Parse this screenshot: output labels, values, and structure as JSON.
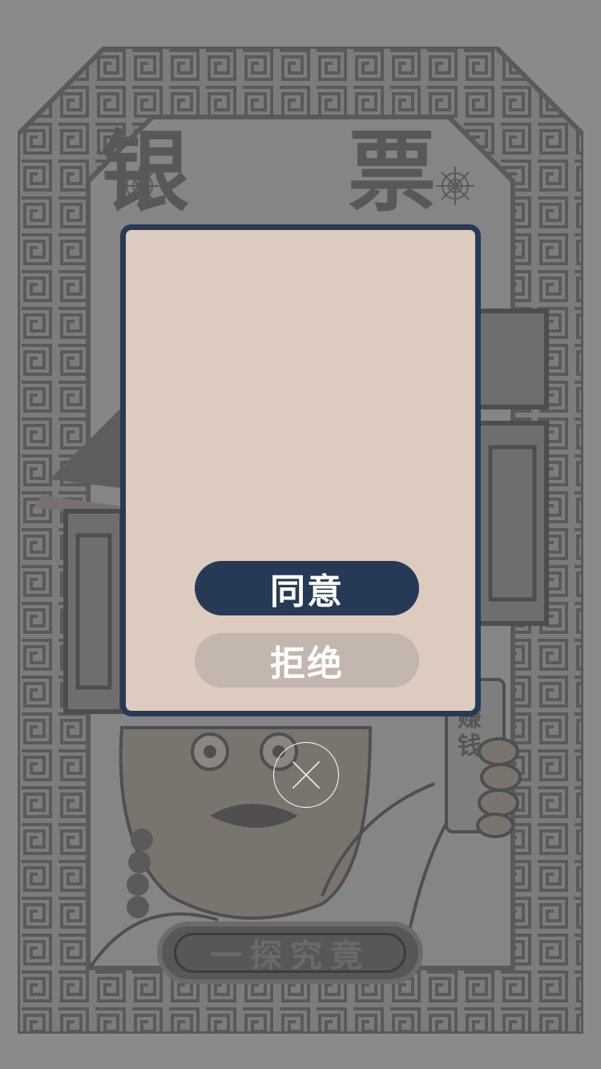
{
  "poster": {
    "title": "银 票",
    "banner_text": "一探究竟",
    "card_text": "赚钱",
    "frame_color": "#5c5c5c",
    "background_color": "#8a8a8a"
  },
  "modal": {
    "agree_label": "同意",
    "refuse_label": "拒绝",
    "background_color": "#dccbbe",
    "accent_color": "#263a56"
  },
  "close": {
    "icon": "close-icon"
  }
}
